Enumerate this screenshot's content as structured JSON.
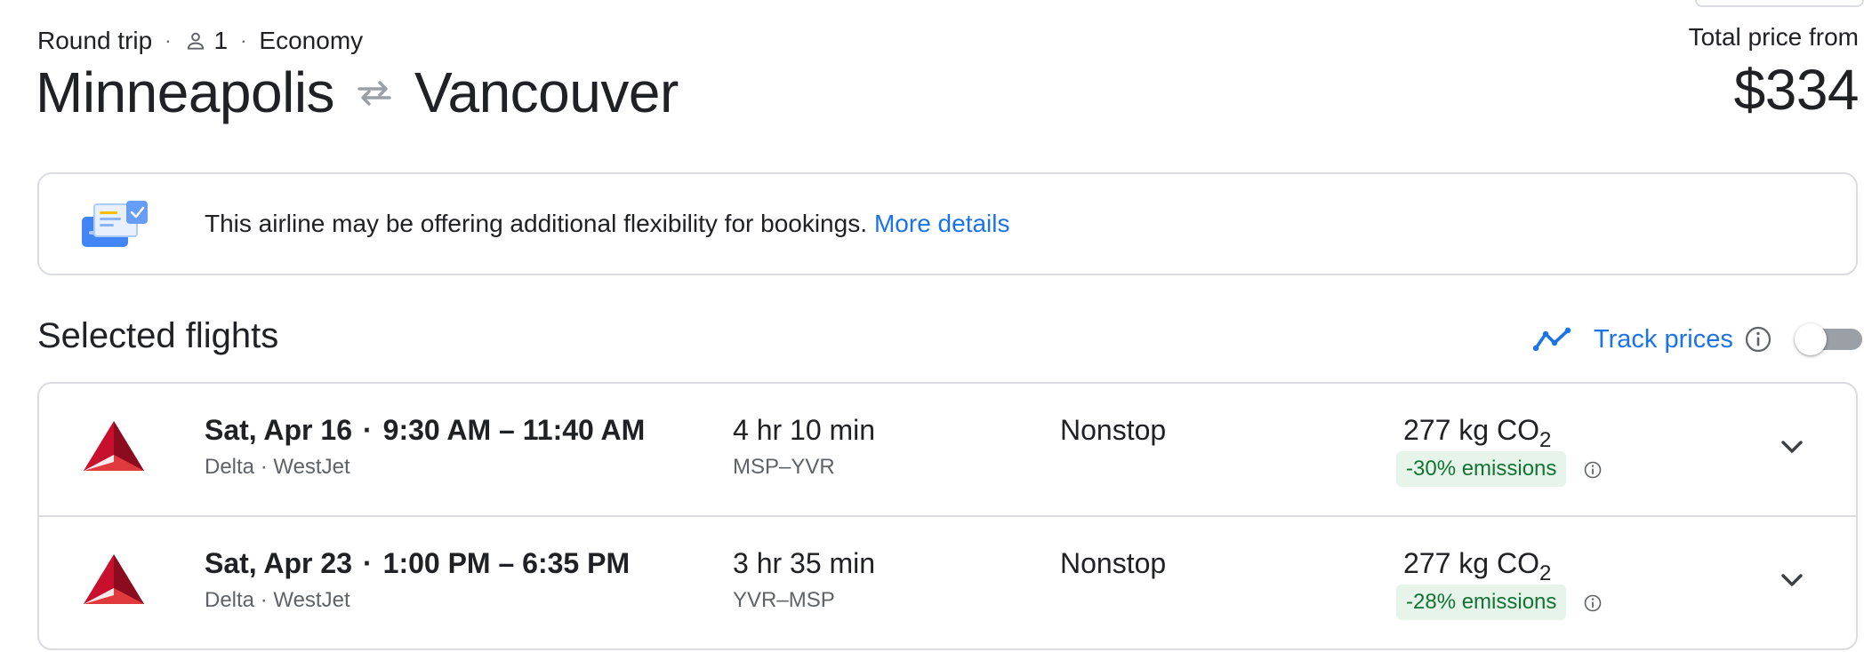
{
  "header": {
    "trip_type": "Round trip",
    "passengers": "1",
    "cabin": "Economy",
    "origin": "Minneapolis",
    "destination": "Vancouver",
    "price_label": "Total price from",
    "price": "$334",
    "icons": {
      "passenger": "person-icon",
      "swap": "swap-arrows-icon"
    }
  },
  "notice": {
    "text": "This airline may be offering additional flexibility for bookings.",
    "link": "More details",
    "icon": "ticket-icon"
  },
  "selected": {
    "title": "Selected flights",
    "track_label": "Track prices",
    "track_enabled": false
  },
  "flights": [
    {
      "date": "Sat, Apr 16",
      "times": "9:30 AM – 11:40 AM",
      "airlines": "Delta · WestJet",
      "duration": "4 hr 10 min",
      "codes": "MSP–YVR",
      "stops": "Nonstop",
      "co2_value": "277 kg CO",
      "co2_sub": "2",
      "emissions": "-30% emissions"
    },
    {
      "date": "Sat, Apr 23",
      "times": "1:00 PM – 6:35 PM",
      "airlines": "Delta · WestJet",
      "duration": "3 hr 35 min",
      "codes": "YVR–MSP",
      "stops": "Nonstop",
      "co2_value": "277 kg CO",
      "co2_sub": "2",
      "emissions": "-28% emissions"
    }
  ],
  "colors": {
    "accent": "#1a73e8",
    "delta_red": "#c8102e",
    "emissions_bg": "#e6f4ea",
    "emissions_text": "#137333"
  }
}
